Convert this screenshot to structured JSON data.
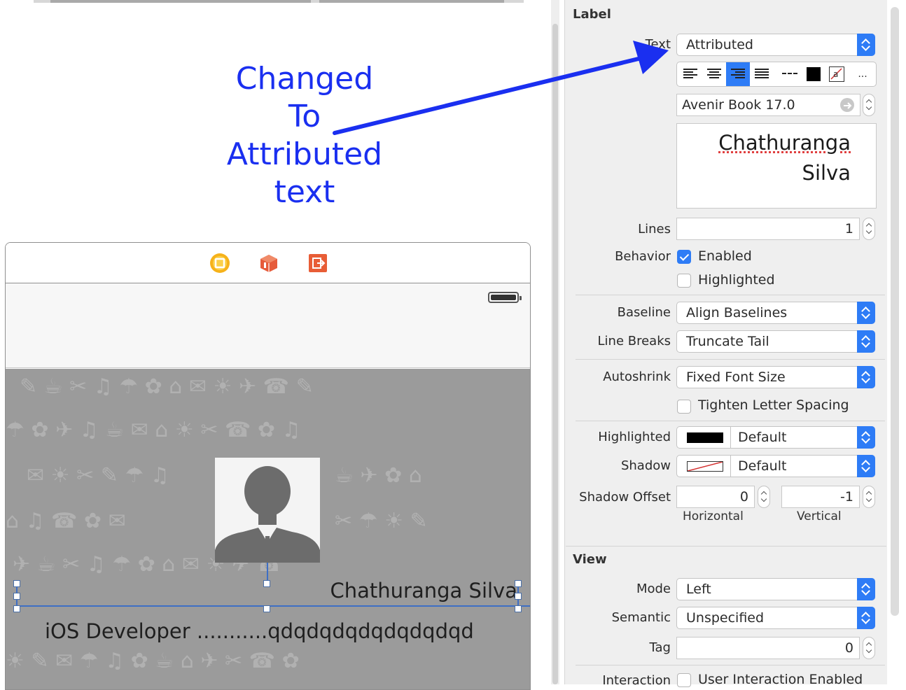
{
  "annotation": {
    "line1": "Changed",
    "line2": "To",
    "line3": "Attributed",
    "line4": "text"
  },
  "scene": {
    "dock_icons": [
      "view-controller-icon",
      "first-responder-icon",
      "exit-icon"
    ],
    "name_label": "Chathuranga Silva",
    "subtitle_label": "iOS Developer ...........qdqdqdqdqdqdqdqd"
  },
  "inspector": {
    "section_label": "Label",
    "text_label": "Text",
    "text_type": "Attributed",
    "font_value": "Avenir Book 17.0",
    "attributed_text_line1": "Chathuranga",
    "attributed_text_line2": "Silva",
    "lines_label": "Lines",
    "lines_value": "1",
    "behavior_label": "Behavior",
    "enabled_label": "Enabled",
    "enabled_checked": true,
    "highlighted_check_label": "Highlighted",
    "highlighted_checked": false,
    "baseline_label": "Baseline",
    "baseline_value": "Align Baselines",
    "line_breaks_label": "Line Breaks",
    "line_breaks_value": "Truncate Tail",
    "autoshrink_label": "Autoshrink",
    "autoshrink_value": "Fixed Font Size",
    "tighten_label": "Tighten Letter Spacing",
    "tighten_checked": false,
    "highlighted_label": "Highlighted",
    "highlighted_value": "Default",
    "highlighted_color": "#000000",
    "shadow_label": "Shadow",
    "shadow_value": "Default",
    "shadow_offset_label": "Shadow Offset",
    "shadow_offset_horizontal": "0",
    "shadow_offset_vertical": "-1",
    "horizontal_caption": "Horizontal",
    "vertical_caption": "Vertical",
    "more_label": "..."
  },
  "view_section": {
    "title": "View",
    "mode_label": "Mode",
    "mode_value": "Left",
    "semantic_label": "Semantic",
    "semantic_value": "Unspecified",
    "tag_label": "Tag",
    "tag_value": "0",
    "interaction_label": "Interaction",
    "user_interaction_label": "User Interaction Enabled",
    "user_interaction_checked": false
  },
  "colors": {
    "accent": "#2e7cf6",
    "annotation": "#1a2ff0",
    "scene_background": "#9b9b9b"
  }
}
